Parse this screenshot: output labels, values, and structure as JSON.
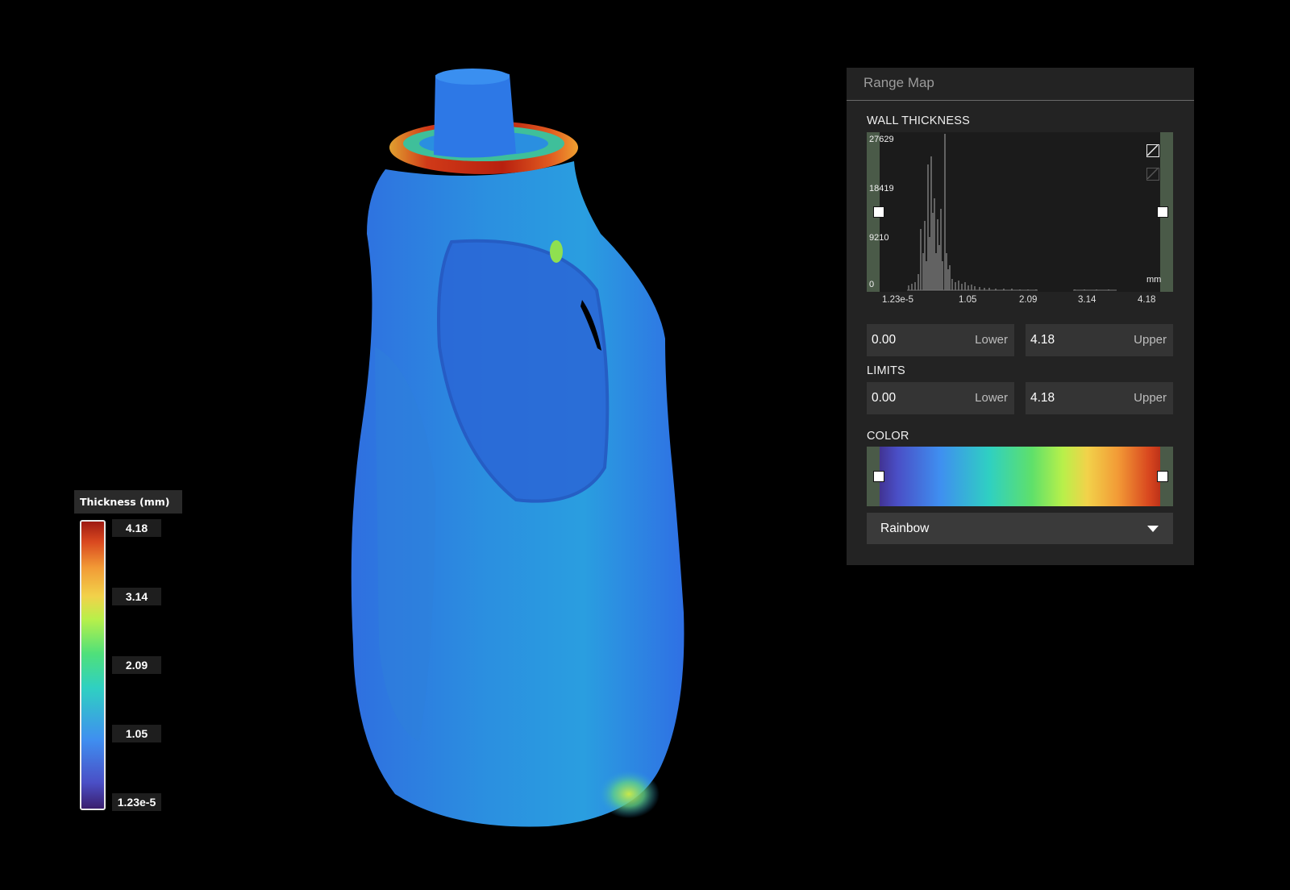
{
  "legend": {
    "title": "Thickness (mm)",
    "labels": [
      "4.18",
      "3.14",
      "2.09",
      "1.05",
      "1.23e-5"
    ]
  },
  "panel": {
    "title": "Range Map",
    "wall_thickness": {
      "label": "WALL THICKNESS",
      "y_ticks": [
        "27629",
        "18419",
        "9210",
        "0"
      ],
      "x_ticks": [
        "1.23e-5",
        "1.05",
        "2.09",
        "3.14",
        "4.18"
      ],
      "unit": "mm",
      "lower": {
        "value": "0.00",
        "tag": "Lower"
      },
      "upper": {
        "value": "4.18",
        "tag": "Upper"
      }
    },
    "limits": {
      "label": "LIMITS",
      "lower": {
        "value": "0.00",
        "tag": "Lower"
      },
      "upper": {
        "value": "4.18",
        "tag": "Upper"
      }
    },
    "color": {
      "label": "COLOR",
      "preset": "Rainbow"
    }
  },
  "colors": {
    "background": "#000000",
    "panel": "#232323",
    "slider_strip": "#4a5a48"
  }
}
